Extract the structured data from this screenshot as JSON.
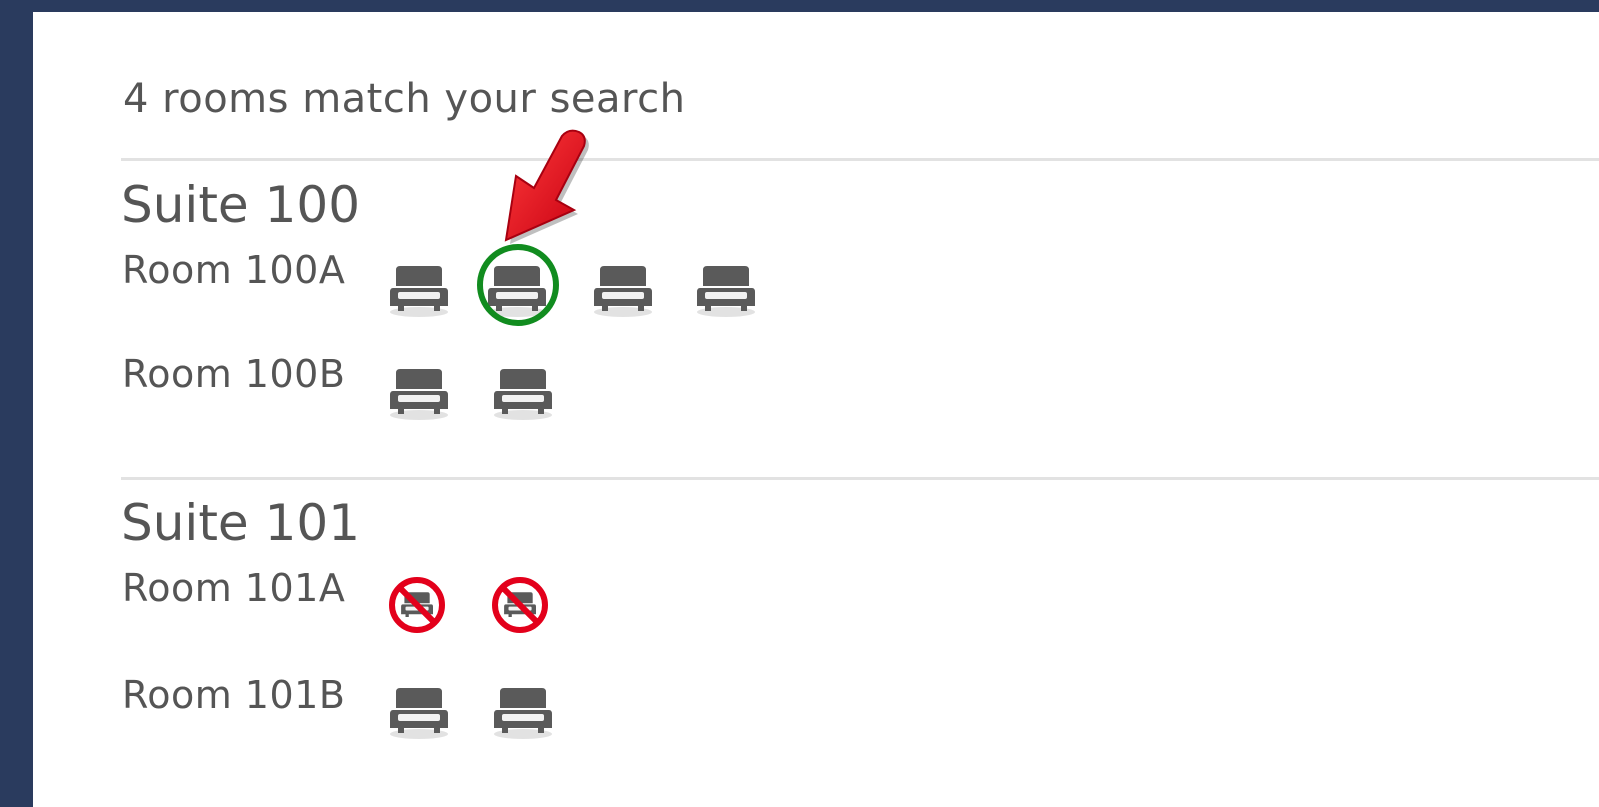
{
  "results": {
    "summary": "4 rooms match your search"
  },
  "suites": [
    {
      "name": "Suite 100",
      "rooms": [
        {
          "name": "Room 100A",
          "beds": [
            "available",
            "available",
            "available",
            "available"
          ]
        },
        {
          "name": "Room 100B",
          "beds": [
            "available",
            "available"
          ]
        }
      ]
    },
    {
      "name": "Suite 101",
      "rooms": [
        {
          "name": "Room 101A",
          "beds": [
            "unavailable",
            "unavailable"
          ]
        },
        {
          "name": "Room 101B",
          "beds": [
            "available",
            "available"
          ]
        }
      ]
    }
  ],
  "annotation": {
    "highlighted_bed": "Room 100A bed 2",
    "ring_color": "#118c1f",
    "arrow_color": "#e3001b"
  },
  "icons": {
    "bed": "bed-icon",
    "unavailable_bed": "bed-unavailable-icon",
    "arrow": "red-arrow-icon"
  },
  "colors": {
    "background": "#2a3b5e",
    "panel": "#ffffff",
    "text": "#555555",
    "bed": "#5a5a5a",
    "unavailable": "#e3001b"
  }
}
